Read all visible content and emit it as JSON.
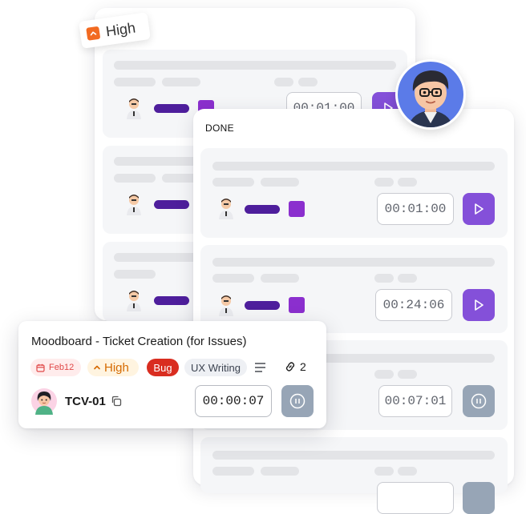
{
  "priority_sticker": {
    "label": "High",
    "icon": "chevron-up-icon",
    "color": "#f26a21"
  },
  "column": {
    "title": "DONE",
    "timers": [
      "00:01:00",
      "00:24:06",
      "00:07:01"
    ]
  },
  "back_column": {
    "timer": "00:01:00"
  },
  "task_card": {
    "title": "Moodboard - Ticket Creation (for Issues)",
    "date": "Feb12",
    "priority": "High",
    "type": "Bug",
    "tag": "UX Writing",
    "links_count": "2",
    "ticket_id": "TCV-01",
    "timer": "00:00:07"
  },
  "colors": {
    "accent": "#8450d9",
    "pause": "#97a5b6",
    "bug": "#d92d20",
    "priority_bg": "#fff4e0",
    "priority_text": "#d56a00",
    "date_bg": "#ffecec",
    "date_text": "#e04848"
  }
}
